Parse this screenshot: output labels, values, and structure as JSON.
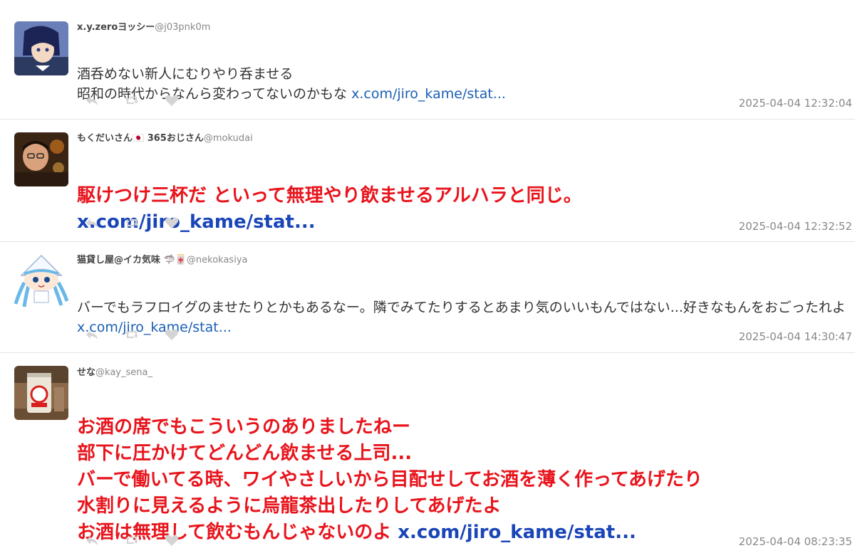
{
  "tweets": [
    {
      "display_name": "x.y.zeroヨッシー",
      "handle": "@j03pnk0m",
      "text": "酒呑めない新人にむりやり呑ませる\n昭和の時代からなんら変わってないのかもな ",
      "link": "x.com/jiro_kame/stat...",
      "timestamp": "2025-04-04 12:32:04",
      "emphasis": "normal"
    },
    {
      "display_name": "もくだいさん🇯🇵 365おじさん",
      "handle": "@mokudai",
      "text": "駆けつけ三杯だ といって無理やり飲ませるアルハラと同じ。\n",
      "link": "x.com/jiro_kame/stat...",
      "timestamp": "2025-04-04 12:32:52",
      "emphasis": "big"
    },
    {
      "display_name": "猫貸し屋@イカ気味 🦈🀄",
      "handle": "@nekokasiya",
      "text": "バーでもラフロイグのませたりとかもあるなー。隣でみてたりするとあまり気のいいもんではない...好きなもんをおごったれよ ",
      "link": "x.com/jiro_kame/stat...",
      "timestamp": "2025-04-04 14:30:47",
      "emphasis": "normal"
    },
    {
      "display_name": "せな",
      "handle": "@kay_sena_",
      "text": "お酒の席でもこういうのありましたねー\n部下に圧かけてどんどん飲ませる上司...\nバーで働いてる時、ワイやさしいから目配せしてお酒を薄く作ってあげたり\n水割りに見えるように烏龍茶出したりしてあげたよ\nお酒は無理して飲むもんじゃないのよ ",
      "link": "x.com/jiro_kame/stat...",
      "timestamp": "2025-04-04 08:23:35",
      "emphasis": "big"
    }
  ],
  "icons": [
    "reply-icon",
    "retweet-icon",
    "like-icon"
  ],
  "colors": {
    "emphasis_text": "#e8141c",
    "link": "#1a5fb4",
    "muted": "#888888",
    "divider": "#e4e4e4"
  }
}
